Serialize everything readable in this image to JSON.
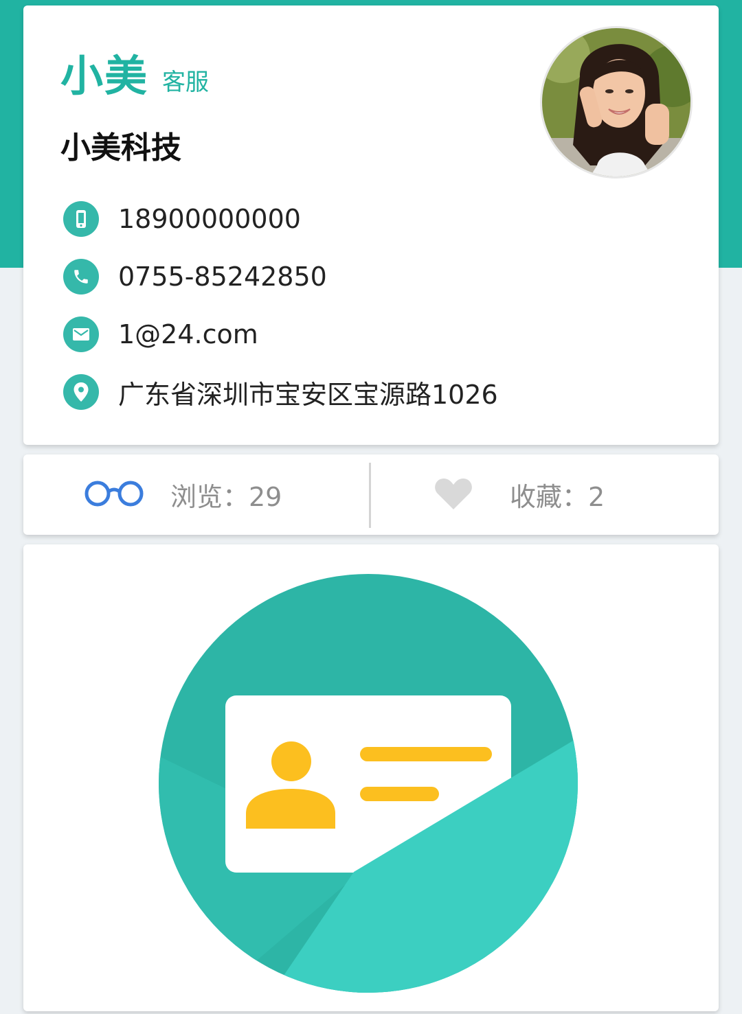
{
  "profile": {
    "name": "小美",
    "role": "客服",
    "company": "小美科技",
    "contacts": [
      {
        "icon": "mobile-phone-icon",
        "value": "18900000000"
      },
      {
        "icon": "telephone-icon",
        "value": "0755-85242850"
      },
      {
        "icon": "email-icon",
        "value": "1@24.com"
      },
      {
        "icon": "location-pin-icon",
        "value": "广东省深圳市宝安区宝源路1026"
      }
    ]
  },
  "stats": {
    "views_label": "浏览：29",
    "favorites_label": "收藏：2"
  },
  "colors": {
    "brand": "#21b3a2",
    "illustration_dark": "#2db5a6",
    "illustration_light": "#3ccfc1",
    "card_accent": "#fcbf1f"
  }
}
